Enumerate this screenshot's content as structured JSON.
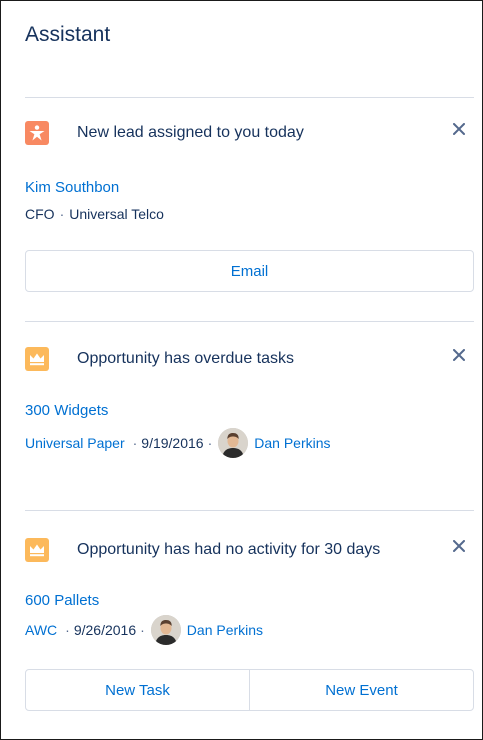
{
  "assistant": {
    "title": "Assistant",
    "cards": [
      {
        "icon": "lead-star-icon",
        "heading": "New lead assigned to you today",
        "record": "Kim Southbon",
        "title_line": "CFO",
        "company": "Universal Telco",
        "actions": [
          "Email"
        ]
      },
      {
        "icon": "opportunity-crown-icon",
        "heading": "Opportunity has overdue tasks",
        "record": "300 Widgets",
        "account": "Universal Paper",
        "date": "9/19/2016",
        "owner": "Dan Perkins"
      },
      {
        "icon": "opportunity-crown-icon",
        "heading": "Opportunity has had no activity for 30 days",
        "record": "600 Pallets",
        "account": "AWC",
        "date": "9/26/2016",
        "owner": "Dan Perkins",
        "actions": [
          "New Task",
          "New Event"
        ]
      }
    ],
    "separator": "·",
    "colors": {
      "lead_icon": "#f88962",
      "opportunity_icon": "#fcb95b",
      "link": "#0070d2",
      "text": "#16325c",
      "border": "#d8dde6"
    }
  }
}
